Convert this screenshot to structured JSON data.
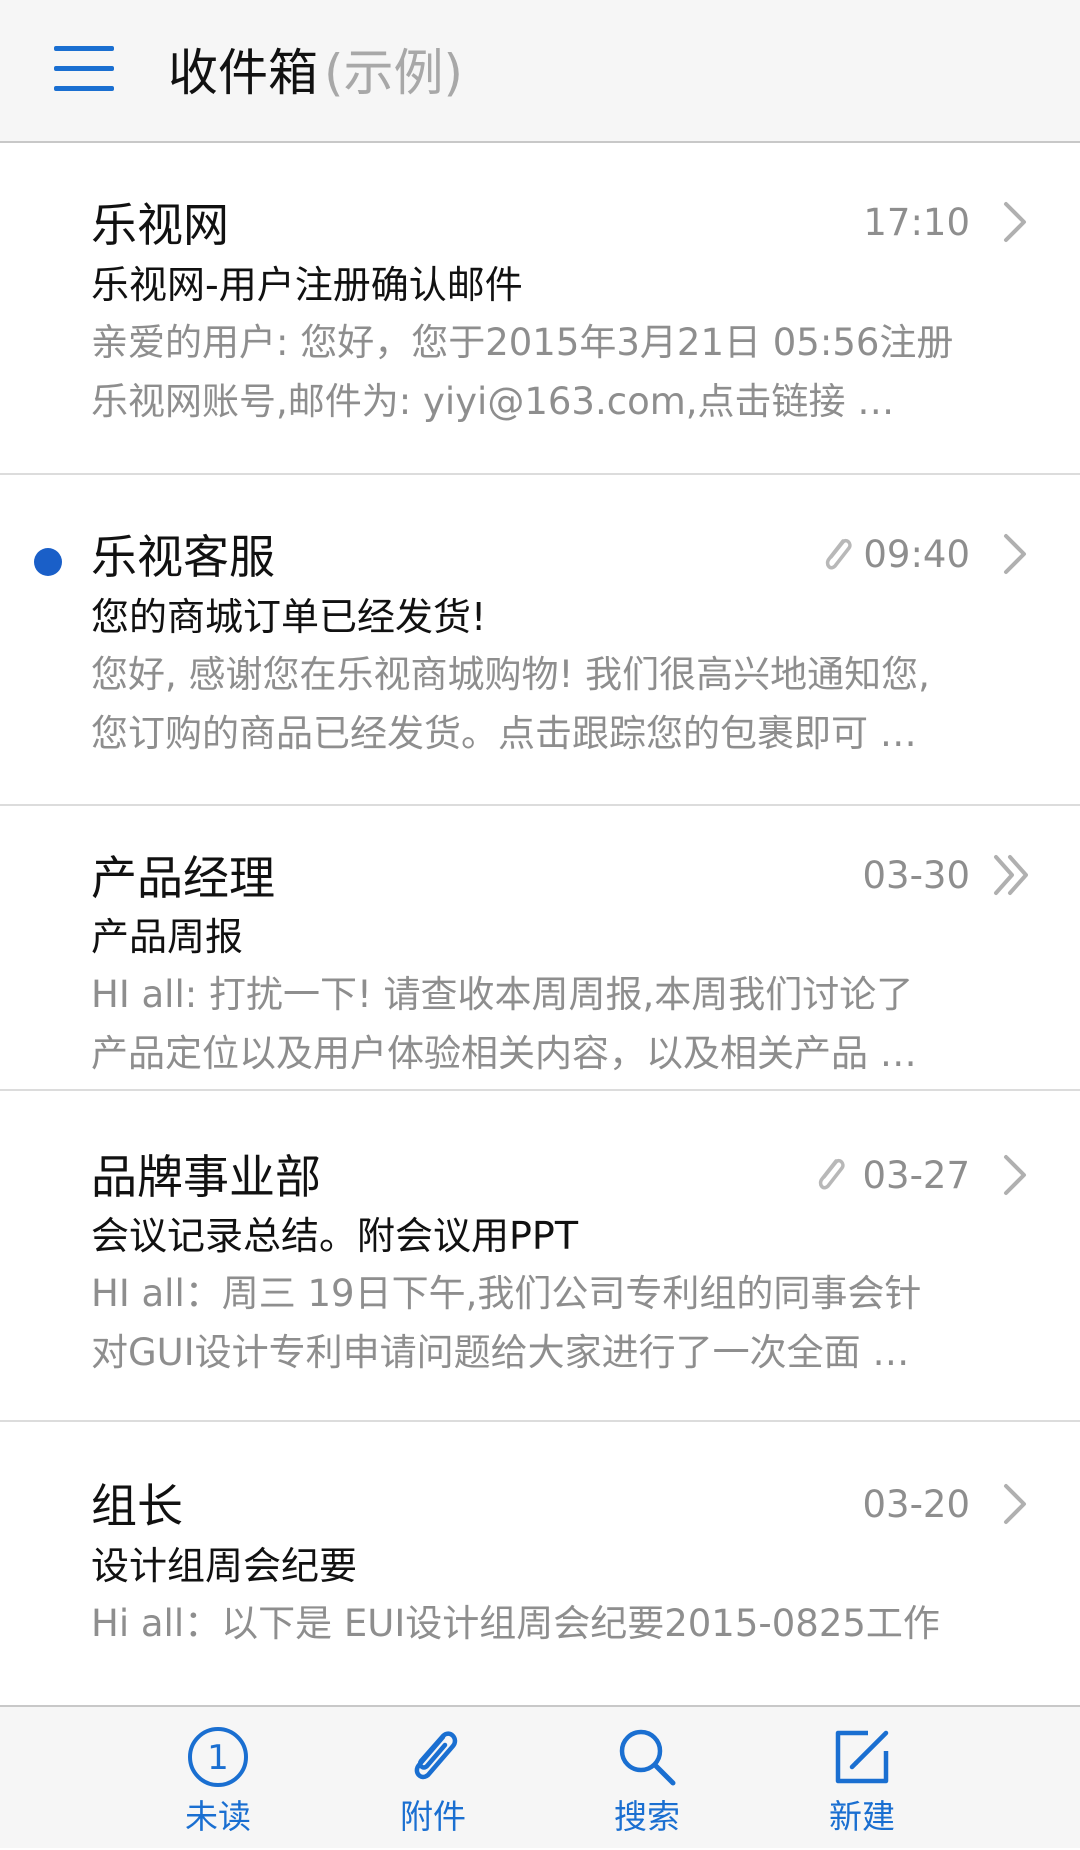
{
  "header": {
    "title": "收件箱",
    "subtitle": "(示例)"
  },
  "mails": [
    {
      "sender": "乐视网",
      "time": "17:10",
      "subject": "乐视网-用户注册确认邮件",
      "preview_line1": "亲爱的用户: 您好，您于2015年3月21日 05:56注册",
      "preview_line2": "乐视网账号,邮件为: yiyi@163.com,点击链接 …",
      "unread": false,
      "attachment": false,
      "chevron": "single"
    },
    {
      "sender": "乐视客服",
      "time": "09:40",
      "subject": "您的商城订单已经发货!",
      "preview_line1": "您好, 感谢您在乐视商城购物! 我们很高兴地通知您,",
      "preview_line2": "您订购的商品已经发货。点击跟踪您的包裹即可 …",
      "unread": true,
      "attachment": true,
      "chevron": "single"
    },
    {
      "sender": "产品经理",
      "time": "03-30",
      "subject": "产品周报",
      "preview_line1": "HI all: 打扰一下! 请查收本周周报,本周我们讨论了",
      "preview_line2": "产品定位以及用户体验相关内容，以及相关产品 …",
      "unread": false,
      "attachment": false,
      "chevron": "double"
    },
    {
      "sender": "品牌事业部",
      "time": "03-27",
      "subject": "会议记录总结。附会议用PPT",
      "preview_line1": "HI all：周三 19日下午,我们公司专利组的同事会针",
      "preview_line2": "对GUI设计专利申请问题给大家进行了一次全面 …",
      "unread": false,
      "attachment": true,
      "chevron": "single"
    },
    {
      "sender": "组长",
      "time": "03-20",
      "subject": "设计组周会纪要",
      "preview_line1": "Hi all：以下是 EUI设计组周会纪要2015-0825工作",
      "preview_line2": "",
      "unread": false,
      "attachment": false,
      "chevron": "single"
    }
  ],
  "tabbar": {
    "tabs": [
      {
        "label": "未读",
        "icon": "unread-count-icon",
        "badge": "1"
      },
      {
        "label": "附件",
        "icon": "paperclip-icon"
      },
      {
        "label": "搜索",
        "icon": "search-icon"
      },
      {
        "label": "新建",
        "icon": "compose-icon"
      }
    ]
  },
  "colors": {
    "accent": "#1a6fd1",
    "unread_dot": "#1a5fc8",
    "secondary_text": "#8e8e8e",
    "bar_background": "#f6f6f6"
  }
}
